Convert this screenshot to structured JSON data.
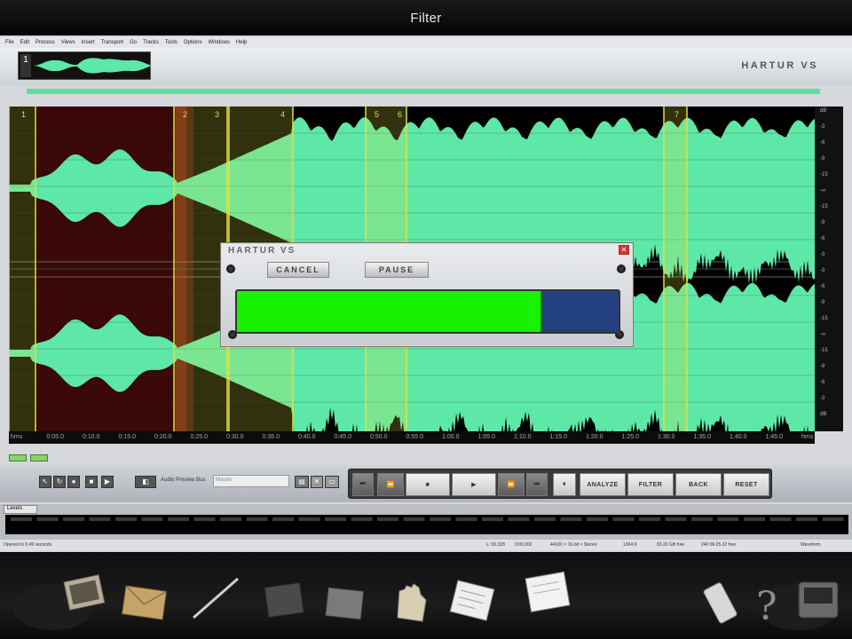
{
  "window": {
    "title": "Filter"
  },
  "menu": [
    "File",
    "Edit",
    "Process",
    "Views",
    "Insert",
    "Transport",
    "Go",
    "Tracks",
    "Tools",
    "Options",
    "Windows",
    "Help"
  ],
  "track": {
    "number": "1"
  },
  "brand": "HARTUR VS",
  "db_scale": [
    "dB",
    "-3",
    "-6",
    "-9",
    "-15",
    "-∞",
    "-15",
    "-9",
    "-6",
    "-3",
    "-3",
    "-6",
    "-9",
    "-15",
    "-∞",
    "-15",
    "-9",
    "-6",
    "-3",
    "dB"
  ],
  "time_ruler": [
    "hms",
    "0:05.0",
    "0:10.0",
    "0:15.0",
    "0:20.0",
    "0:25.0",
    "0:30.0",
    "0:35.0",
    "0:40.0",
    "0:45.0",
    "0:50.0",
    "0:55.0",
    "1:00.0",
    "1:05.0",
    "1:10.0",
    "1:15.0",
    "1:20.0",
    "1:25.0",
    "1:30.0",
    "1:35.0",
    "1:40.0",
    "1:45.0",
    "hms"
  ],
  "marker_labels": [
    "1",
    "2",
    "3",
    "4",
    "5",
    "6",
    "7"
  ],
  "audio_preview": {
    "label": "Audio Preview Bus",
    "value": "Master"
  },
  "transport": {
    "analyze": "ANALYZE",
    "filter": "FILTER",
    "back": "BACK",
    "reset": "RESET"
  },
  "levels": {
    "tab": "Levels"
  },
  "status": {
    "left": "Opened in 0.49 seconds",
    "position": "L: 00.328",
    "length": "0:00.002",
    "format": "44100 × 16-bit × Stereo",
    "rate": "1304 K",
    "disk1": "83.20 GB free",
    "disk2": "240:06:25.22 free",
    "mode": "Waveform"
  },
  "dialog": {
    "title": "HARTUR VS",
    "cancel": "CANCEL",
    "pause": "PAUSE",
    "progress": 0.8
  },
  "inventory": [
    "photo",
    "envelope",
    "wand",
    "slate",
    "note",
    "gloves",
    "document",
    "letter",
    "phone",
    "hint",
    "device"
  ],
  "colors": {
    "waveform": "#5ee8a8",
    "selection_red": "#3a0808",
    "marker_yellow": "#e0e040",
    "progress_fill": "#18f200",
    "progress_bg": "#234080"
  }
}
